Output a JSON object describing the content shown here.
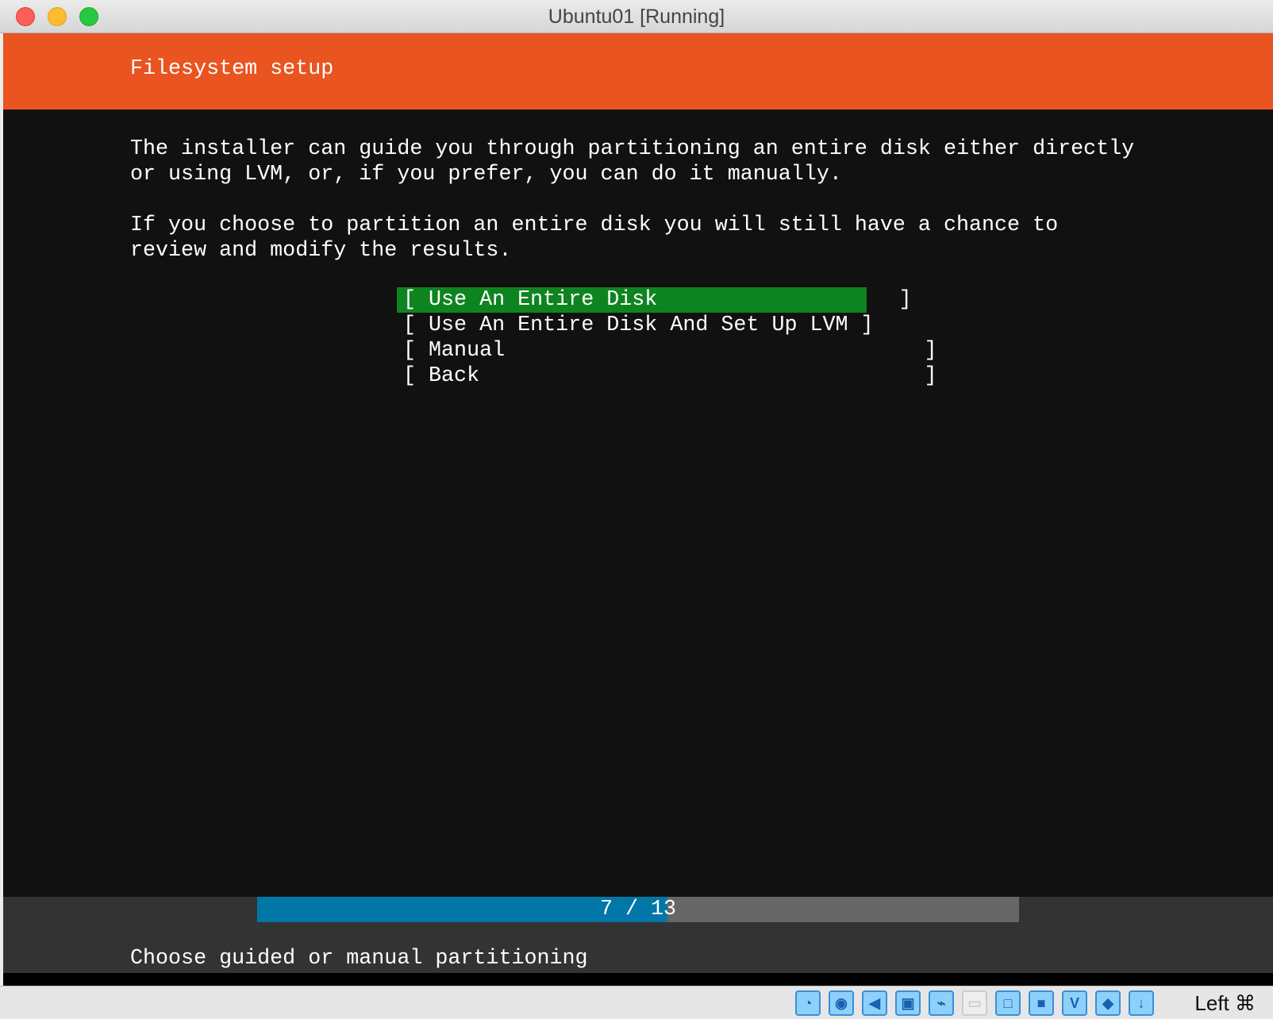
{
  "window": {
    "title": "Ubuntu01 [Running]"
  },
  "header": {
    "title": "Filesystem setup"
  },
  "body": {
    "lines": [
      "The installer can guide you through partitioning an entire disk either directly",
      "or using LVM, or, if you prefer, you can do it manually.",
      "If you choose to partition an entire disk you will still have a chance to",
      "review and modify the results."
    ]
  },
  "menu": {
    "items": [
      {
        "label": "[ Use An Entire Disk                   ]",
        "selected": true
      },
      {
        "label": "[ Use An Entire Disk And Set Up LVM ]",
        "selected": false
      },
      {
        "label": "[ Manual                                 ]",
        "selected": false
      },
      {
        "label": "[ Back                                   ]",
        "selected": false
      }
    ]
  },
  "progress": {
    "current": 7,
    "total": 13,
    "text": "7 / 13"
  },
  "footer": {
    "hint": "Choose guided or manual partitioning"
  },
  "statusbar": {
    "host_key": "Left ⌘",
    "icons": [
      "hard-disk-icon",
      "optical-drive-icon",
      "audio-icon",
      "network-icon",
      "usb-icon",
      "shared-folder-icon",
      "display-icon",
      "video-capture-icon",
      "cpu-vt-icon",
      "mouse-integration-icon",
      "keyboard-capture-icon"
    ]
  },
  "colors": {
    "header": "#e95420",
    "selected": "#0e8420",
    "progress": "#0077a6"
  }
}
